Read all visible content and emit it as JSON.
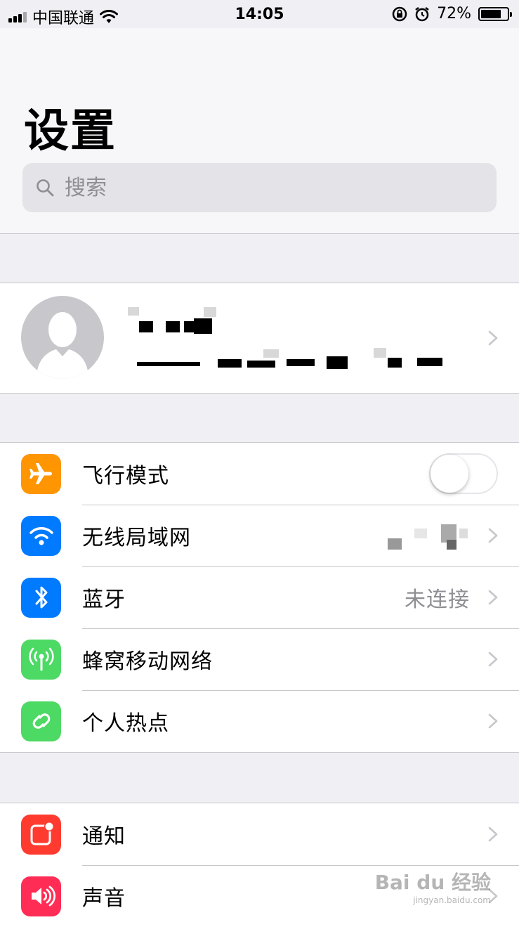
{
  "status_bar": {
    "carrier": "中国联通",
    "time": "14:05",
    "battery_percent": "72%"
  },
  "header": {
    "title": "设置",
    "search_placeholder": "搜索"
  },
  "groups": {
    "connectivity": [
      {
        "label": "飞行模式",
        "icon": "airplane-icon",
        "color": "#ff9500",
        "toggle_on": false
      },
      {
        "label": "无线局域网",
        "icon": "wifi-icon",
        "color": "#007aff"
      },
      {
        "label": "蓝牙",
        "icon": "bluetooth-icon",
        "color": "#007aff",
        "value": "未连接"
      },
      {
        "label": "蜂窝移动网络",
        "icon": "cellular-icon",
        "color": "#4cd964"
      },
      {
        "label": "个人热点",
        "icon": "hotspot-icon",
        "color": "#4cd964"
      }
    ],
    "notifications": [
      {
        "label": "通知",
        "icon": "notifications-icon",
        "color": "#ff3b30"
      },
      {
        "label": "声音",
        "icon": "sound-icon",
        "color": "#ff2d55"
      }
    ]
  },
  "watermark": {
    "brand": "Bai du 经验",
    "url": "jingyan.baidu.com"
  }
}
